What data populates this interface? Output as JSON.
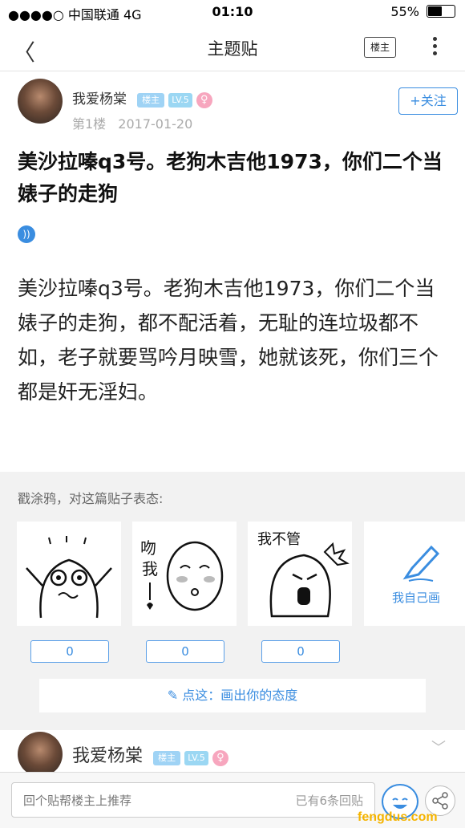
{
  "status_bar": {
    "carrier": "●●●●○ 中国联通  4G",
    "time": "01:10",
    "battery": "55%",
    "battery_level": 0.55
  },
  "nav": {
    "title": "主题贴",
    "host_only": "楼主"
  },
  "author": {
    "name": "我爱杨棠",
    "host_tag": "楼主",
    "level": "LV.5",
    "gender_symbol": "♀",
    "floor": "第1楼",
    "date": "2017-01-20",
    "follow": "+关注"
  },
  "post": {
    "title": "美沙拉嗪q3号。老狗木吉他1973，你们二个当婊子的走狗",
    "body": "美沙拉嗪q3号。老狗木吉他1973，你们二个当婊子的走狗，都不配活着，无耻的连垃圾都不如，老子就要骂吟月映雪，她就该死，你们三个都是奸无淫妇。"
  },
  "reaction": {
    "prompt": "戳涂鸦，对这篇贴子表态:",
    "stickers": [
      {
        "icon": "scared-doodle-icon",
        "count": "0"
      },
      {
        "icon": "shy-doodle-icon",
        "text": "吻我",
        "count": "0"
      },
      {
        "icon": "dont-care-doodle-icon",
        "text": "我不管",
        "count": "0"
      }
    ],
    "draw_own": "我自己画",
    "draw_prompt": "点这：画出你的态度"
  },
  "floor2": {
    "name": "我爱杨棠",
    "host_tag": "楼主",
    "level": "LV.5",
    "gender_symbol": "♀"
  },
  "bottom": {
    "reply_placeholder": "回个贴帮楼主上推荐",
    "reply_count": "已有6条回贴"
  },
  "watermark": "fengdus.com",
  "colors": {
    "accent": "#3a8de0",
    "tag_blue": "#9fd3f5",
    "female_pink": "#f7a6be",
    "watermark": "#f5b400"
  }
}
